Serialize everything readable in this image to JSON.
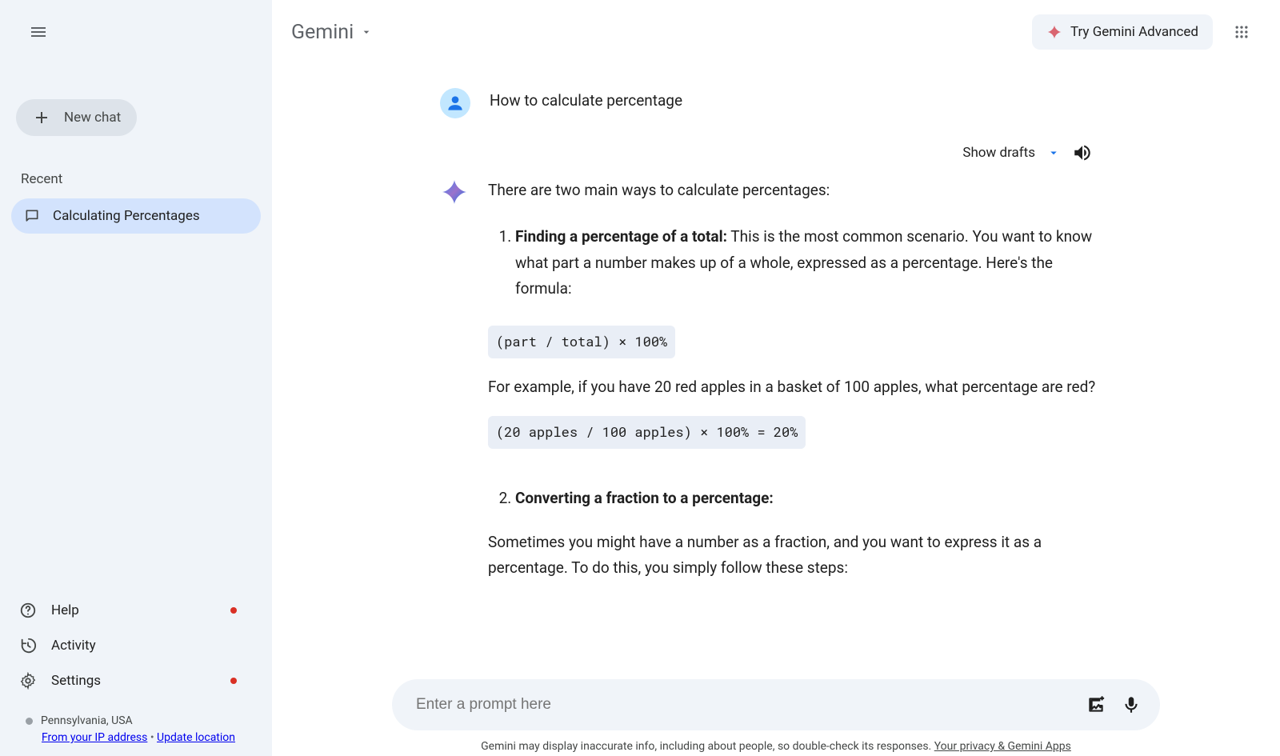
{
  "sidebar": {
    "new_chat": "New chat",
    "recent_label": "Recent",
    "chats": [
      "Calculating Percentages"
    ],
    "bottom": [
      {
        "label": "Help",
        "has_dot": true
      },
      {
        "label": "Activity",
        "has_dot": false
      },
      {
        "label": "Settings",
        "has_dot": true
      }
    ],
    "location": {
      "text": "Pennsylvania, USA",
      "ip_label": "From your IP address",
      "separator": " • ",
      "update_label": "Update location"
    }
  },
  "header": {
    "brand": "Gemini",
    "try_btn": "Try Gemini Advanced"
  },
  "conversation": {
    "user_msg": "How to calculate percentage",
    "drafts_label": "Show drafts",
    "answer_intro": "There are two main ways to calculate percentages:",
    "item1_bold": "Finding a percentage of a total:",
    "item1_rest": " This is the most common scenario. You want to know what part a number makes up of a whole, expressed as a percentage. Here's the formula:",
    "code1": "(part / total) × 100%",
    "example_text": "For example, if you have 20 red apples in a basket of 100 apples, what percentage are red?",
    "code2": "(20 apples / 100 apples) × 100% = 20%",
    "item2_bold": "Converting a fraction to a percentage:",
    "para2": "Sometimes you might have a number as a fraction, and you want to express it as a percentage. To do this, you simply follow these steps:"
  },
  "input": {
    "placeholder": "Enter a prompt here"
  },
  "disclaimer": {
    "text": "Gemini may display inaccurate info, including about people, so double-check its responses. ",
    "link": "Your privacy & Gemini Apps"
  }
}
